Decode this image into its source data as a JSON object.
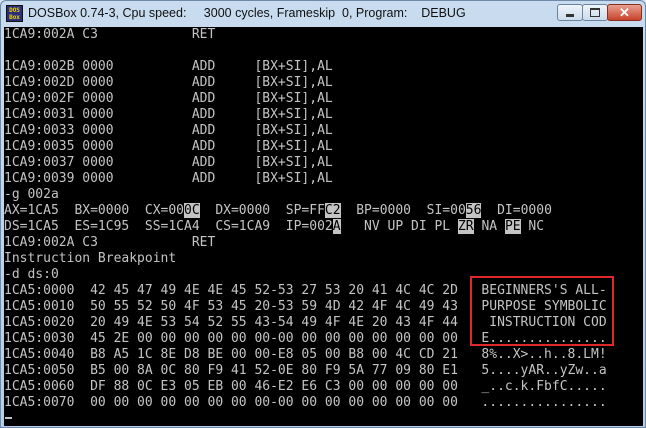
{
  "window": {
    "icon_text": "DOS\nBox",
    "title": "DOSBox 0.74-3, Cpu speed:     3000 cycles, Frameskip  0, Program:    DEBUG",
    "minimize_glyph": "",
    "maximize_glyph": "",
    "close_glyph": "✕"
  },
  "console": {
    "lines": [
      "1CA9:002A C3            RET",
      "",
      "1CA9:002B 0000          ADD     [BX+SI],AL",
      "1CA9:002D 0000          ADD     [BX+SI],AL",
      "1CA9:002F 0000          ADD     [BX+SI],AL",
      "1CA9:0031 0000          ADD     [BX+SI],AL",
      "1CA9:0033 0000          ADD     [BX+SI],AL",
      "1CA9:0035 0000          ADD     [BX+SI],AL",
      "1CA9:0037 0000          ADD     [BX+SI],AL",
      "1CA9:0039 0000          ADD     [BX+SI],AL",
      "-g 002a",
      "",
      "",
      "1CA9:002A C3            RET",
      "Instruction Breakpoint",
      "-d ds:0",
      "1CA5:0000  42 45 47 49 4E 4E 45 52-53 27 53 20 41 4C 4C 2D   BEGINNERS'S ALL-",
      "1CA5:0010  50 55 52 50 4F 53 45 20-53 59 4D 42 4F 4C 49 43   PURPOSE SYMBOLIC",
      "1CA5:0020  20 49 4E 53 54 52 55 43-54 49 4F 4E 20 43 4F 44    INSTRUCTION COD",
      "1CA5:0030  45 2E 00 00 00 00 00 00-00 00 00 00 00 00 00 00   E...............",
      "1CA5:0040  B8 A5 1C 8E D8 BE 00 00-E8 05 00 B8 00 4C CD 21   8%..X>..h..8.LM!",
      "1CA5:0050  B5 00 8A 0C 80 F9 41 52-0E 80 F9 5A 77 09 80 E1   5....yAR..yZw..a",
      "1CA5:0060  DF 88 0C E3 05 EB 00 46-E2 E6 C3 00 00 00 00 00   _..c.k.FbfC.....",
      "1CA5:0070  00 00 00 00 00 00 00 00-00 00 00 00 00 00 00 00   ................",
      "-"
    ],
    "registers_1": {
      "p1": "AX=1CA5  BX=0000  CX=00",
      "h1": "0C",
      "p2": "  DX=0000  SP=FF",
      "h2": "C2",
      "p3": "  BP=0000  SI=00",
      "h3": "56",
      "p4": "  DI=0000"
    },
    "registers_2": {
      "p1": "DS=1CA5  ES=1C95  SS=1CA4  CS=1CA9  IP=002",
      "h1": "A",
      "p2": "   NV UP DI PL ",
      "h2": "ZR",
      "p3": " NA ",
      "h3": "PE",
      "p4": " NC"
    }
  }
}
